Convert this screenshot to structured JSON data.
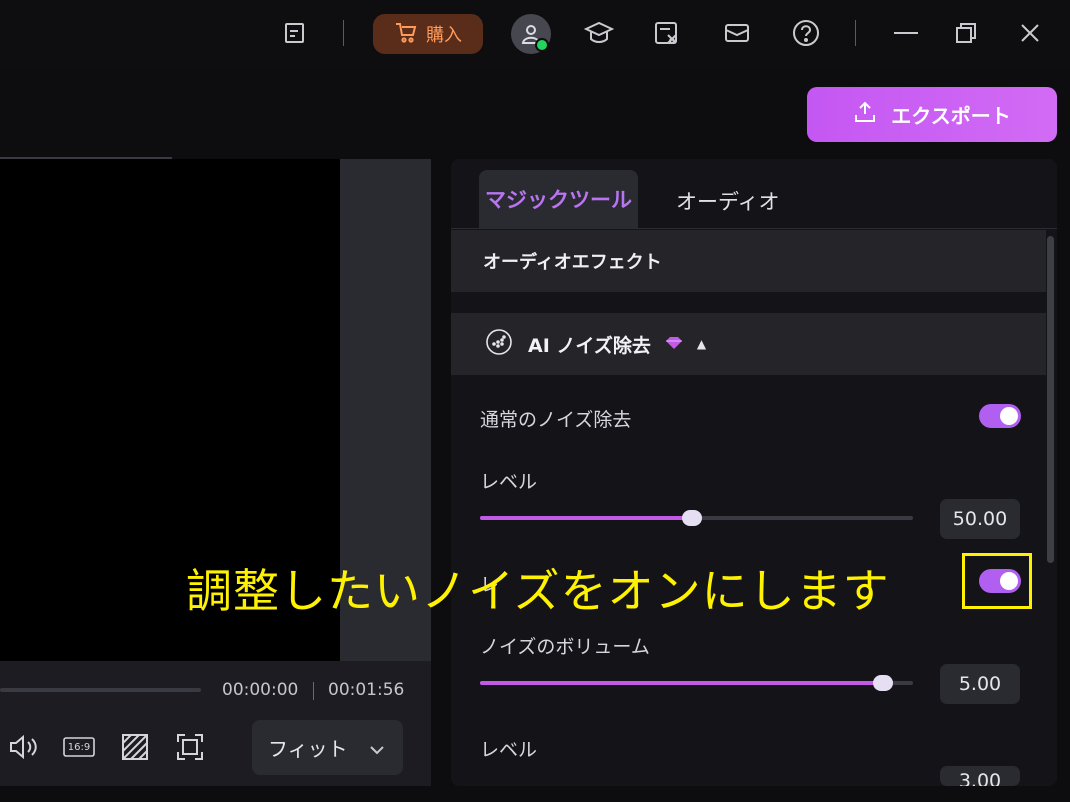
{
  "topbar": {
    "buy_label": "購入",
    "icons": [
      "notes-icon",
      "cart-icon",
      "user-icon",
      "tutorial-icon",
      "cloud-clip-icon",
      "mail-icon",
      "help-icon",
      "minimize-icon",
      "restore-icon",
      "close-icon"
    ]
  },
  "export": {
    "label": "エクスポート"
  },
  "preview": {
    "time_current": "00:00:00",
    "time_total": "00:01:56",
    "fit_label": "フィット",
    "controls": [
      "volume-icon",
      "aspect-ratio-icon",
      "mask-icon",
      "fullscreen-icon"
    ],
    "aspect_label": "16:9"
  },
  "panel": {
    "tabs": [
      {
        "label": "マジックツール",
        "active": true
      },
      {
        "label": "オーディオ",
        "active": false
      }
    ],
    "section_title": "オーディオエフェクト",
    "effect": {
      "title": "AI ノイズ除去",
      "rows": [
        {
          "label": "通常のノイズ除去",
          "toggle": true
        },
        {
          "label": "レベル",
          "value": "50.00",
          "fraction": 0.49
        },
        {
          "label": "レ",
          "toggle": true
        },
        {
          "label": "ノイズのボリューム",
          "value": "5.00",
          "fraction": 0.93
        },
        {
          "label": "レベル",
          "value": "3.00"
        }
      ]
    }
  },
  "overlay": {
    "caption": "調整したいノイズをオンにします"
  },
  "colors": {
    "accent": "#b05ff0",
    "overlay": "#fff200",
    "buy": "#ff9a5a"
  }
}
